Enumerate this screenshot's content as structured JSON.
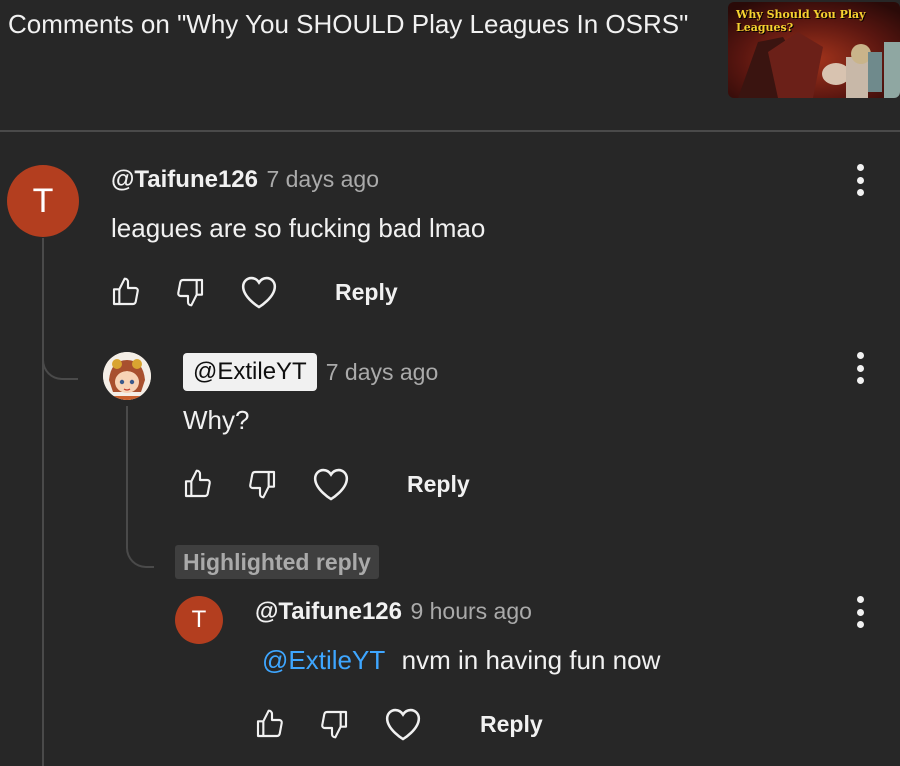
{
  "header": {
    "title": "Comments on \"Why You SHOULD Play Leagues In OSRS\"",
    "thumbnail_caption": "Why Should You Play Leagues?"
  },
  "comments": [
    {
      "avatar_letter": "T",
      "handle": "@Taifune126",
      "time": "7 days ago",
      "text": "leagues are so fucking bad lmao",
      "reply_label": "Reply"
    },
    {
      "avatar": "anime-character-avatar",
      "handle": "@ExtileYT",
      "time": "7 days ago",
      "text": "Why?",
      "reply_label": "Reply"
    },
    {
      "highlight_label": "Highlighted reply",
      "avatar_letter": "T",
      "handle": "@Taifune126",
      "time": "9 hours ago",
      "mention": "@ExtileYT",
      "text": "nvm in having fun now",
      "reply_label": "Reply"
    }
  ],
  "colors": {
    "background": "#272727",
    "avatar": "#b33e1f",
    "mention": "#3ea6ff"
  }
}
